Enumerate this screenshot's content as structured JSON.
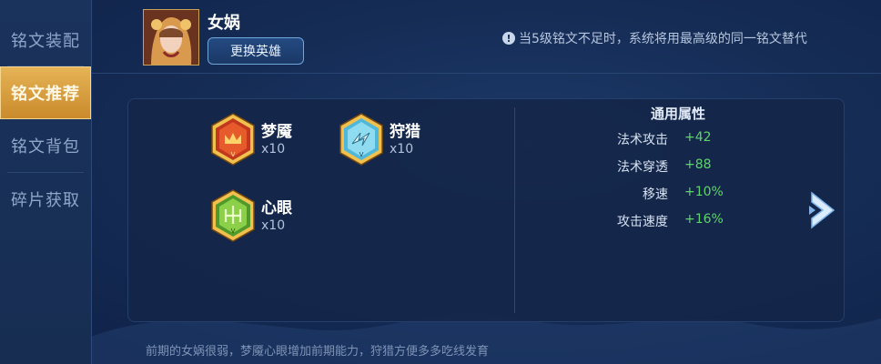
{
  "sidebar": {
    "items": [
      {
        "label": "铭文装配",
        "active": false
      },
      {
        "label": "铭文推荐",
        "active": true
      },
      {
        "label": "铭文背包",
        "active": false
      },
      {
        "label": "碎片获取",
        "active": false
      }
    ]
  },
  "header": {
    "hero_name": "女娲",
    "change_button": "更换英雄",
    "notice_icon": "info-icon",
    "notice_text": "当5级铭文不足时，系统将用最高级的同一铭文替代"
  },
  "runes": [
    {
      "name": "梦魇",
      "count": "x10",
      "color": "red",
      "icon": "rune-red-icon"
    },
    {
      "name": "狩猎",
      "count": "x10",
      "color": "blue",
      "icon": "rune-blue-icon"
    },
    {
      "name": "心眼",
      "count": "x10",
      "color": "green",
      "icon": "rune-green-icon"
    }
  ],
  "stats": {
    "title": "通用属性",
    "rows": [
      {
        "label": "法术攻击",
        "value": "+42"
      },
      {
        "label": "法术穿透",
        "value": "+88"
      },
      {
        "label": "移速",
        "value": "+10%"
      },
      {
        "label": "攻击速度",
        "value": "+16%"
      }
    ]
  },
  "next_icon": "chevron-right-icon",
  "footer": {
    "note": "前期的女娲很弱，梦魇心眼增加前期能力，狩猎方便多多吃线发育"
  },
  "colors": {
    "accent_gold": "#e6b457",
    "stat_green": "#5fd46a",
    "background": "#152c55"
  }
}
